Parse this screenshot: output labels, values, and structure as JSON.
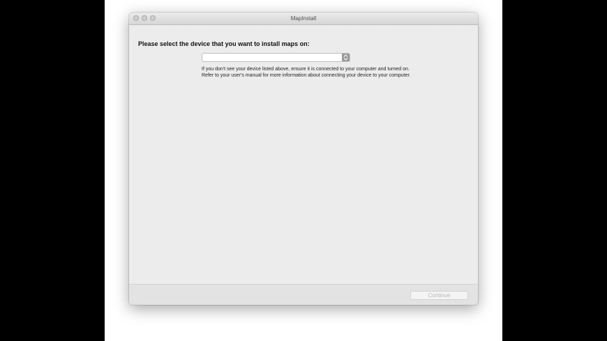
{
  "window": {
    "title": "MapInstall"
  },
  "content": {
    "heading": "Please select the device that you want to install maps on:",
    "device_select": {
      "selected_value": ""
    },
    "help_text": "If you don't see your device listed above, ensure it is connected to your computer and turned on.  Refer to your user's manual for more information about connecting your device to your computer."
  },
  "footer": {
    "continue_label": "Continue"
  },
  "colors": {
    "window_bg": "#ececec",
    "disabled_text": "#b9b9b9"
  }
}
